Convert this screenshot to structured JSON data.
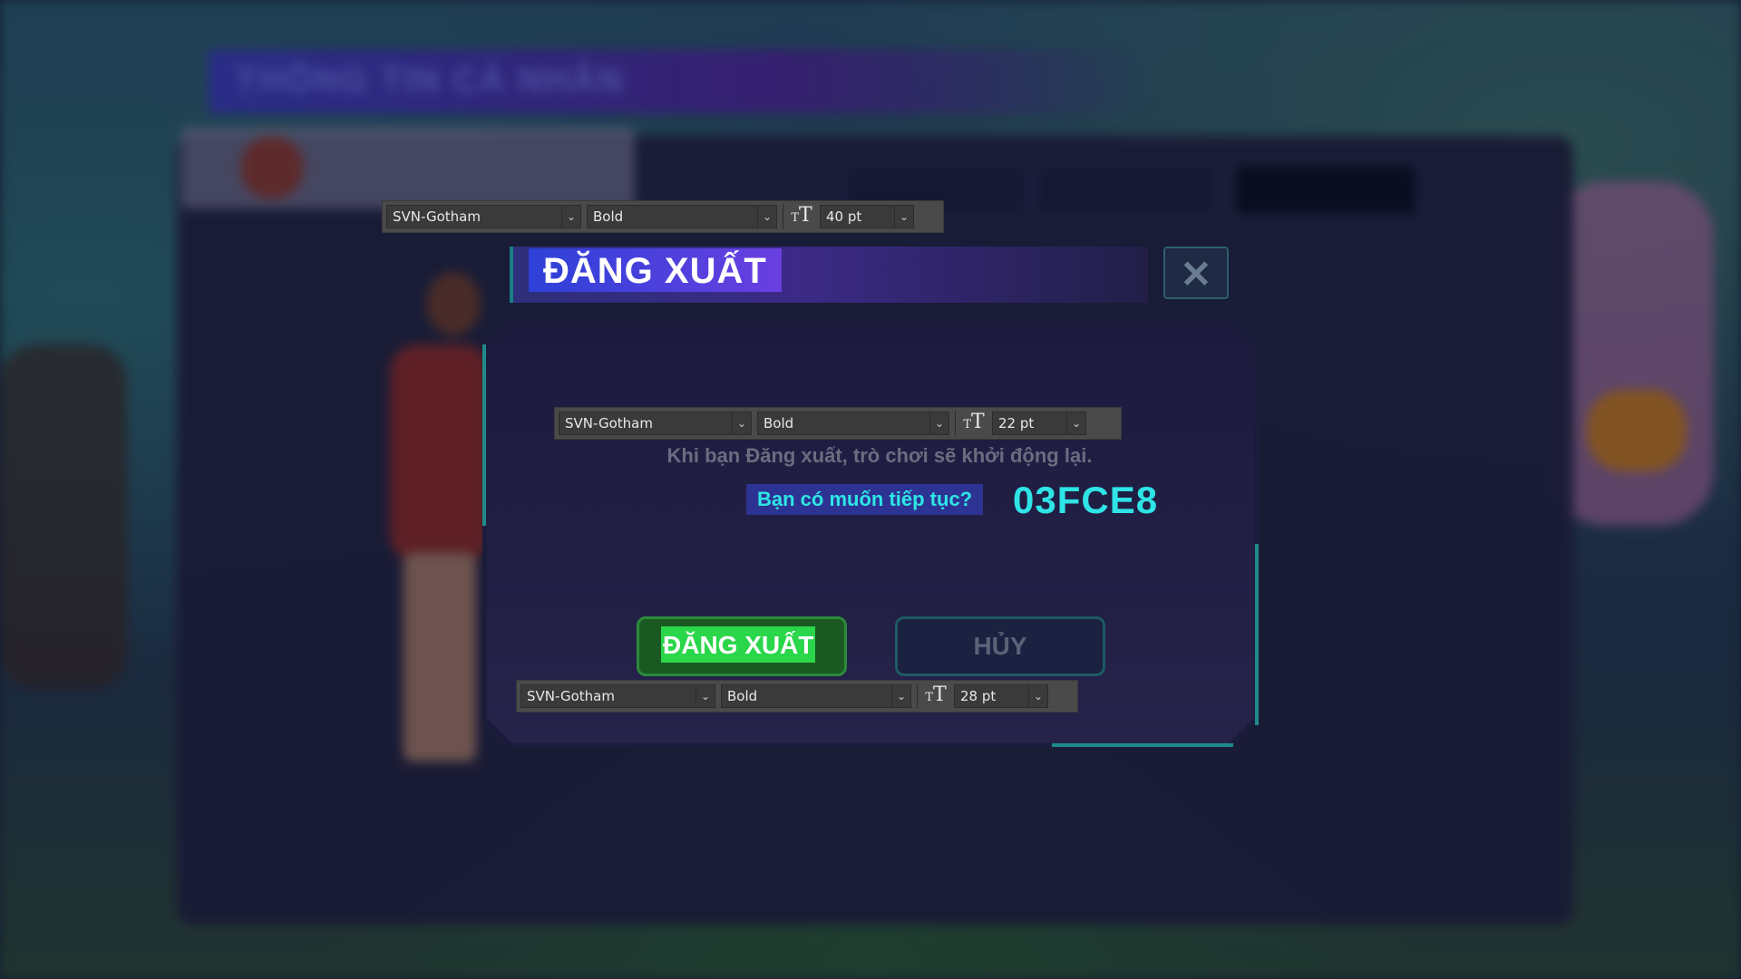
{
  "background": {
    "title": "THÔNG TIN CÁ NHÂN"
  },
  "dialog": {
    "title": "ĐĂNG XUẤT",
    "close_icon": "close-icon",
    "message": "Khi bạn Đăng xuất, trò chơi sẽ khởi động lại.",
    "question": "Bạn có muốn tiếp tục?",
    "hex_code": "03FCE8",
    "confirm_label": "ĐĂNG XUẤT",
    "cancel_label": "HỦY"
  },
  "toolbars": {
    "title": {
      "font": "SVN-Gotham",
      "style": "Bold",
      "size": "40 pt"
    },
    "message": {
      "font": "SVN-Gotham",
      "style": "Bold",
      "size": "22 pt"
    },
    "buttons": {
      "font": "SVN-Gotham",
      "style": "Bold",
      "size": "28 pt"
    }
  },
  "colors": {
    "accent_cyan": "#03FCE8",
    "confirm_green": "#2ad64a",
    "title_purple": "#5a3fe0"
  }
}
